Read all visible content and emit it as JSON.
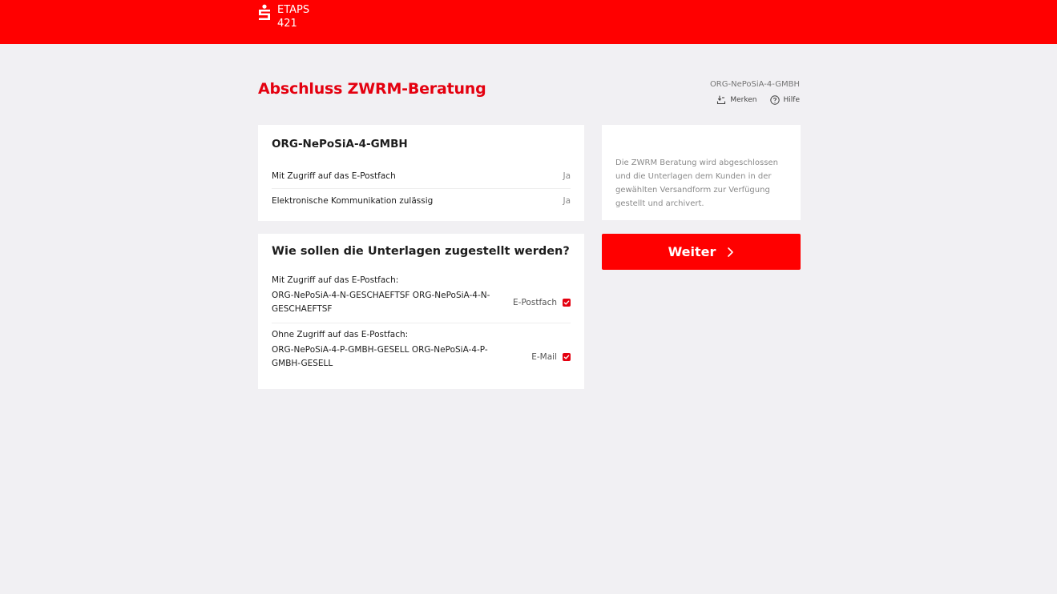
{
  "header": {
    "app_name": "ETAPS",
    "app_number": "421",
    "logo_icon": "sparkasse-s-logo",
    "bg_color": "#ff0000"
  },
  "page": {
    "title": "Abschluss ZWRM-Beratung",
    "customer": "ORG-NePoSiA-4-GMBH",
    "tools": {
      "remember_label": "Merken",
      "help_label": "Hilfe"
    }
  },
  "info_card": {
    "title": "ORG-NePoSiA-4-GMBH",
    "rows": [
      {
        "label": "Mit Zugriff auf das E-Postfach",
        "value": "Ja"
      },
      {
        "label": "Elektronische Kommunikation zulässig",
        "value": "Ja"
      }
    ]
  },
  "delivery_card": {
    "title": "Wie sollen die Unterlagen zugestellt werden?",
    "groups": [
      {
        "label": "Mit Zugriff auf das E-Postfach:",
        "recipients": "ORG-NePoSiA-4-N-GESCHAEFTSF ORG-NePoSiA-4-N-GESCHAEFTSF",
        "option": "E-Postfach",
        "checked": true
      },
      {
        "label": "Ohne Zugriff auf das E-Postfach:",
        "recipients": "ORG-NePoSiA-4-P-GMBH-GESELL ORG-NePoSiA-4-P-GMBH-GESELL",
        "option": "E-Mail",
        "checked": true
      }
    ]
  },
  "note_card": {
    "text": "Die ZWRM Beratung wird abgeschlossen und die Unterlagen dem Kunden in der gewählten Versandform zur Verfügung gestellt und archivert."
  },
  "next_button": {
    "label": "Weiter",
    "color": "#ff0000"
  },
  "accent_color": "#e4000f"
}
